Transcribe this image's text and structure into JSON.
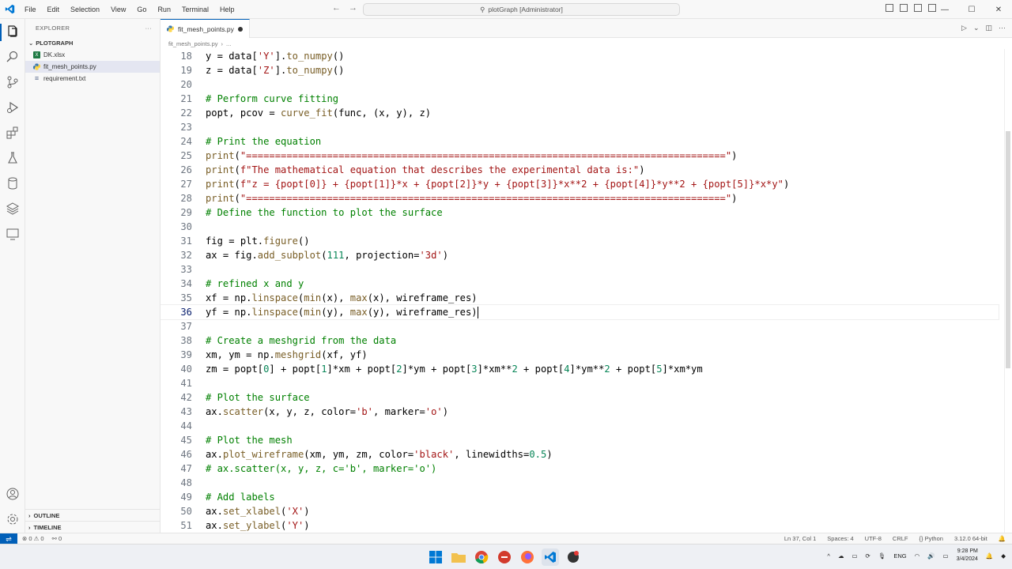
{
  "titlebar": {
    "menu": [
      "File",
      "Edit",
      "Selection",
      "View",
      "Go",
      "Run",
      "Terminal",
      "Help"
    ],
    "command_center": "plotGraph [Administrator]"
  },
  "sidebar": {
    "title": "EXPLORER",
    "folder": "PLOTGRAPH",
    "files": [
      {
        "name": "DK.xlsx",
        "type": "xlsx"
      },
      {
        "name": "fit_mesh_points.py",
        "type": "py",
        "selected": true
      },
      {
        "name": "requirement.txt",
        "type": "txt"
      }
    ],
    "outline": "OUTLINE",
    "timeline": "TIMELINE"
  },
  "tab": {
    "label": "fit_mesh_points.py"
  },
  "breadcrumb": [
    "fit_mesh_points.py",
    "..."
  ],
  "editor": {
    "current_line": 36,
    "lines": [
      {
        "n": "18",
        "text": "y = data['Y'].to_numpy()"
      },
      {
        "n": "19",
        "text": "z = data['Z'].to_numpy()"
      },
      {
        "n": "20",
        "text": ""
      },
      {
        "n": "21",
        "text": "# Perform curve fitting"
      },
      {
        "n": "22",
        "text": "popt, pcov = curve_fit(func, (x, y), z)"
      },
      {
        "n": "23",
        "text": ""
      },
      {
        "n": "24",
        "text": "# Print the equation"
      },
      {
        "n": "25",
        "text": "print(\"===================================================================================\")"
      },
      {
        "n": "26",
        "text": "print(f\"The mathematical equation that describes the experimental data is:\")"
      },
      {
        "n": "27",
        "text": "print(f\"z = {popt[0]} + {popt[1]}*x + {popt[2]}*y + {popt[3]}*x**2 + {popt[4]}*y**2 + {popt[5]}*x*y\")"
      },
      {
        "n": "28",
        "text": "print(\"===================================================================================\")"
      },
      {
        "n": "29",
        "text": "# Define the function to plot the surface"
      },
      {
        "n": "30",
        "text": ""
      },
      {
        "n": "31",
        "text": "fig = plt.figure()"
      },
      {
        "n": "32",
        "text": "ax = fig.add_subplot(111, projection='3d')"
      },
      {
        "n": "33",
        "text": ""
      },
      {
        "n": "34",
        "text": "# refined x and y"
      },
      {
        "n": "35",
        "text": "xf = np.linspace(min(x), max(x), wireframe_res)"
      },
      {
        "n": "36",
        "text": "yf = np.linspace(min(y), max(y), wireframe_res)"
      },
      {
        "n": "37",
        "text": ""
      },
      {
        "n": "38",
        "text": "# Create a meshgrid from the data"
      },
      {
        "n": "39",
        "text": "xm, ym = np.meshgrid(xf, yf)"
      },
      {
        "n": "40",
        "text": "zm = popt[0] + popt[1]*xm + popt[2]*ym + popt[3]*xm**2 + popt[4]*ym**2 + popt[5]*xm*ym"
      },
      {
        "n": "41",
        "text": ""
      },
      {
        "n": "42",
        "text": "# Plot the surface"
      },
      {
        "n": "43",
        "text": "ax.scatter(x, y, z, color='b', marker='o')"
      },
      {
        "n": "44",
        "text": ""
      },
      {
        "n": "45",
        "text": "# Plot the mesh"
      },
      {
        "n": "46",
        "text": "ax.plot_wireframe(xm, ym, zm, color='black', linewidths=0.5)"
      },
      {
        "n": "47",
        "text": "# ax.scatter(x, y, z, c='b', marker='o')"
      },
      {
        "n": "48",
        "text": ""
      },
      {
        "n": "49",
        "text": "# Add labels"
      },
      {
        "n": "50",
        "text": "ax.set_xlabel('X')"
      },
      {
        "n": "51",
        "text": "ax.set_ylabel('Y')"
      }
    ]
  },
  "statusbar": {
    "problems": "⊗ 0 ⚠ 0",
    "ports": "⚯ 0",
    "position": "Ln 37, Col 1",
    "spaces": "Spaces: 4",
    "encoding": "UTF-8",
    "eol": "CRLF",
    "language": "{} Python",
    "interpreter": "3.12.0 64-bit"
  },
  "taskbar": {
    "language": "ENG",
    "time": "9:28 PM",
    "date": "3/4/2024"
  },
  "colors": {
    "accent": "#005fb8",
    "comment": "#008000",
    "function": "#795e26",
    "string": "#a31515",
    "variable": "#001080",
    "number": "#098658"
  }
}
